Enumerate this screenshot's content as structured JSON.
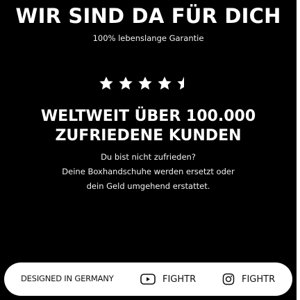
{
  "hero": {
    "title": "WIR SIND DA FÜR DICH",
    "subtitle": "100% lebenslange Garantie"
  },
  "rating": {
    "value": 4.5,
    "max": 5
  },
  "claim": {
    "line1": "WELTWEIT ÜBER 100.000",
    "line2": "ZUFRIEDENE KUNDEN"
  },
  "message": {
    "line1": "Du bist nicht zufrieden?",
    "line2": "Deine Boxhandschuhe werden ersetzt oder",
    "line3": "dein Geld umgehend erstattet."
  },
  "footer": {
    "designed": "DESIGNED IN GERMANY",
    "youtube_label": "FIGHTR",
    "instagram_label": "FIGHTR",
    "youtube_icon": "youtube-icon",
    "instagram_icon": "instagram-icon"
  },
  "colors": {
    "background": "#000000",
    "text": "#ffffff",
    "footer_background": "#ffffff"
  }
}
